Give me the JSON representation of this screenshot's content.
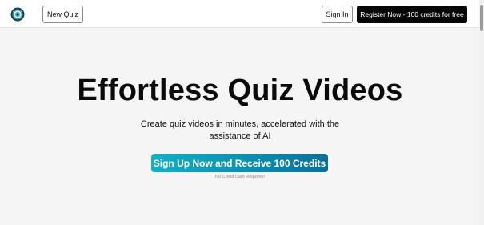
{
  "header": {
    "logo_icon": "quiz-logo-icon",
    "new_quiz_label": "New Quiz",
    "sign_in_label": "Sign In",
    "register_label": "Register Now - 100 credits for free"
  },
  "hero": {
    "title": "Effortless Quiz Videos",
    "subtitle": "Create quiz videos in minutes, accelerated with the assistance of AI",
    "cta_label": "Sign Up Now and Receive 100 Credits",
    "note": "No Credit Card Required!"
  },
  "colors": {
    "cta_start": "#12b1c4",
    "cta_end": "#0b6f99",
    "register_bg": "#050505"
  }
}
